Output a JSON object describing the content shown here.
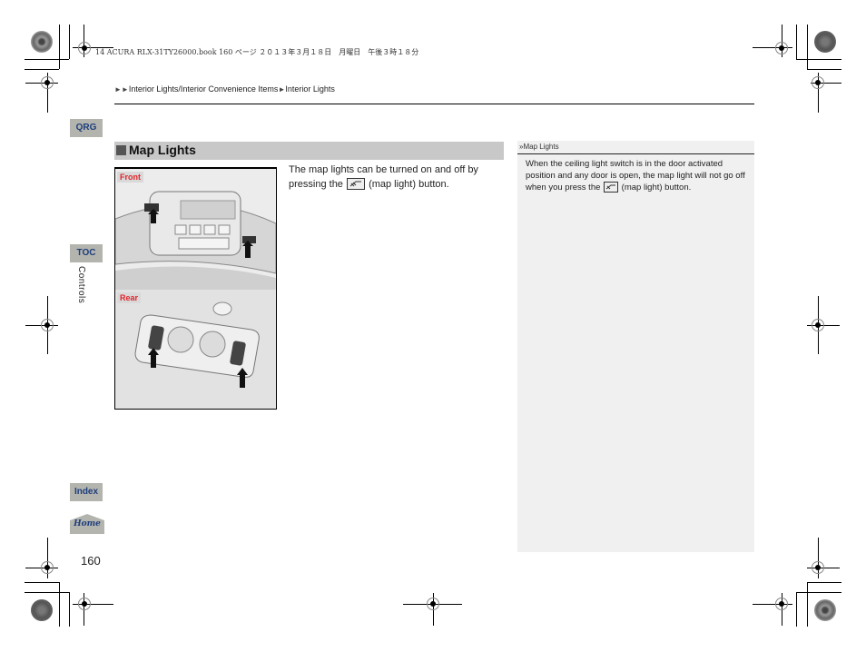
{
  "print_header": "14 ACURA RLX-31TY26000.book  160 ページ  ２０１３年３月１８日　月曜日　午後３時１８分",
  "breadcrumb": {
    "arrows": "►►",
    "path": "Interior Lights/Interior Convenience Items",
    "separator": "►",
    "current": "Interior Lights"
  },
  "side_nav": {
    "qrg": "QRG",
    "toc": "TOC",
    "section_label": "Controls",
    "index": "Index",
    "home": "Home"
  },
  "page_number": "160",
  "section": {
    "title": "Map Lights",
    "body_before": "The map lights can be turned on and off by pressing the",
    "icon": "map-light-icon",
    "body_after": "(map light) button."
  },
  "figure": {
    "front_label": "Front",
    "rear_label": "Rear"
  },
  "note": {
    "marker": "»",
    "title": "Map Lights",
    "text_before": "When the ceiling light switch is in the door activated position and any door is open, the map light will not go off when you press the",
    "text_after": "(map light) button."
  },
  "colors": {
    "nav_button_bg": "#b4b4ae",
    "nav_button_text": "#1d3e7c",
    "section_bar": "#c8c8c8",
    "figure_label_text": "#e3242b",
    "note_bg": "#f0f0f0"
  }
}
